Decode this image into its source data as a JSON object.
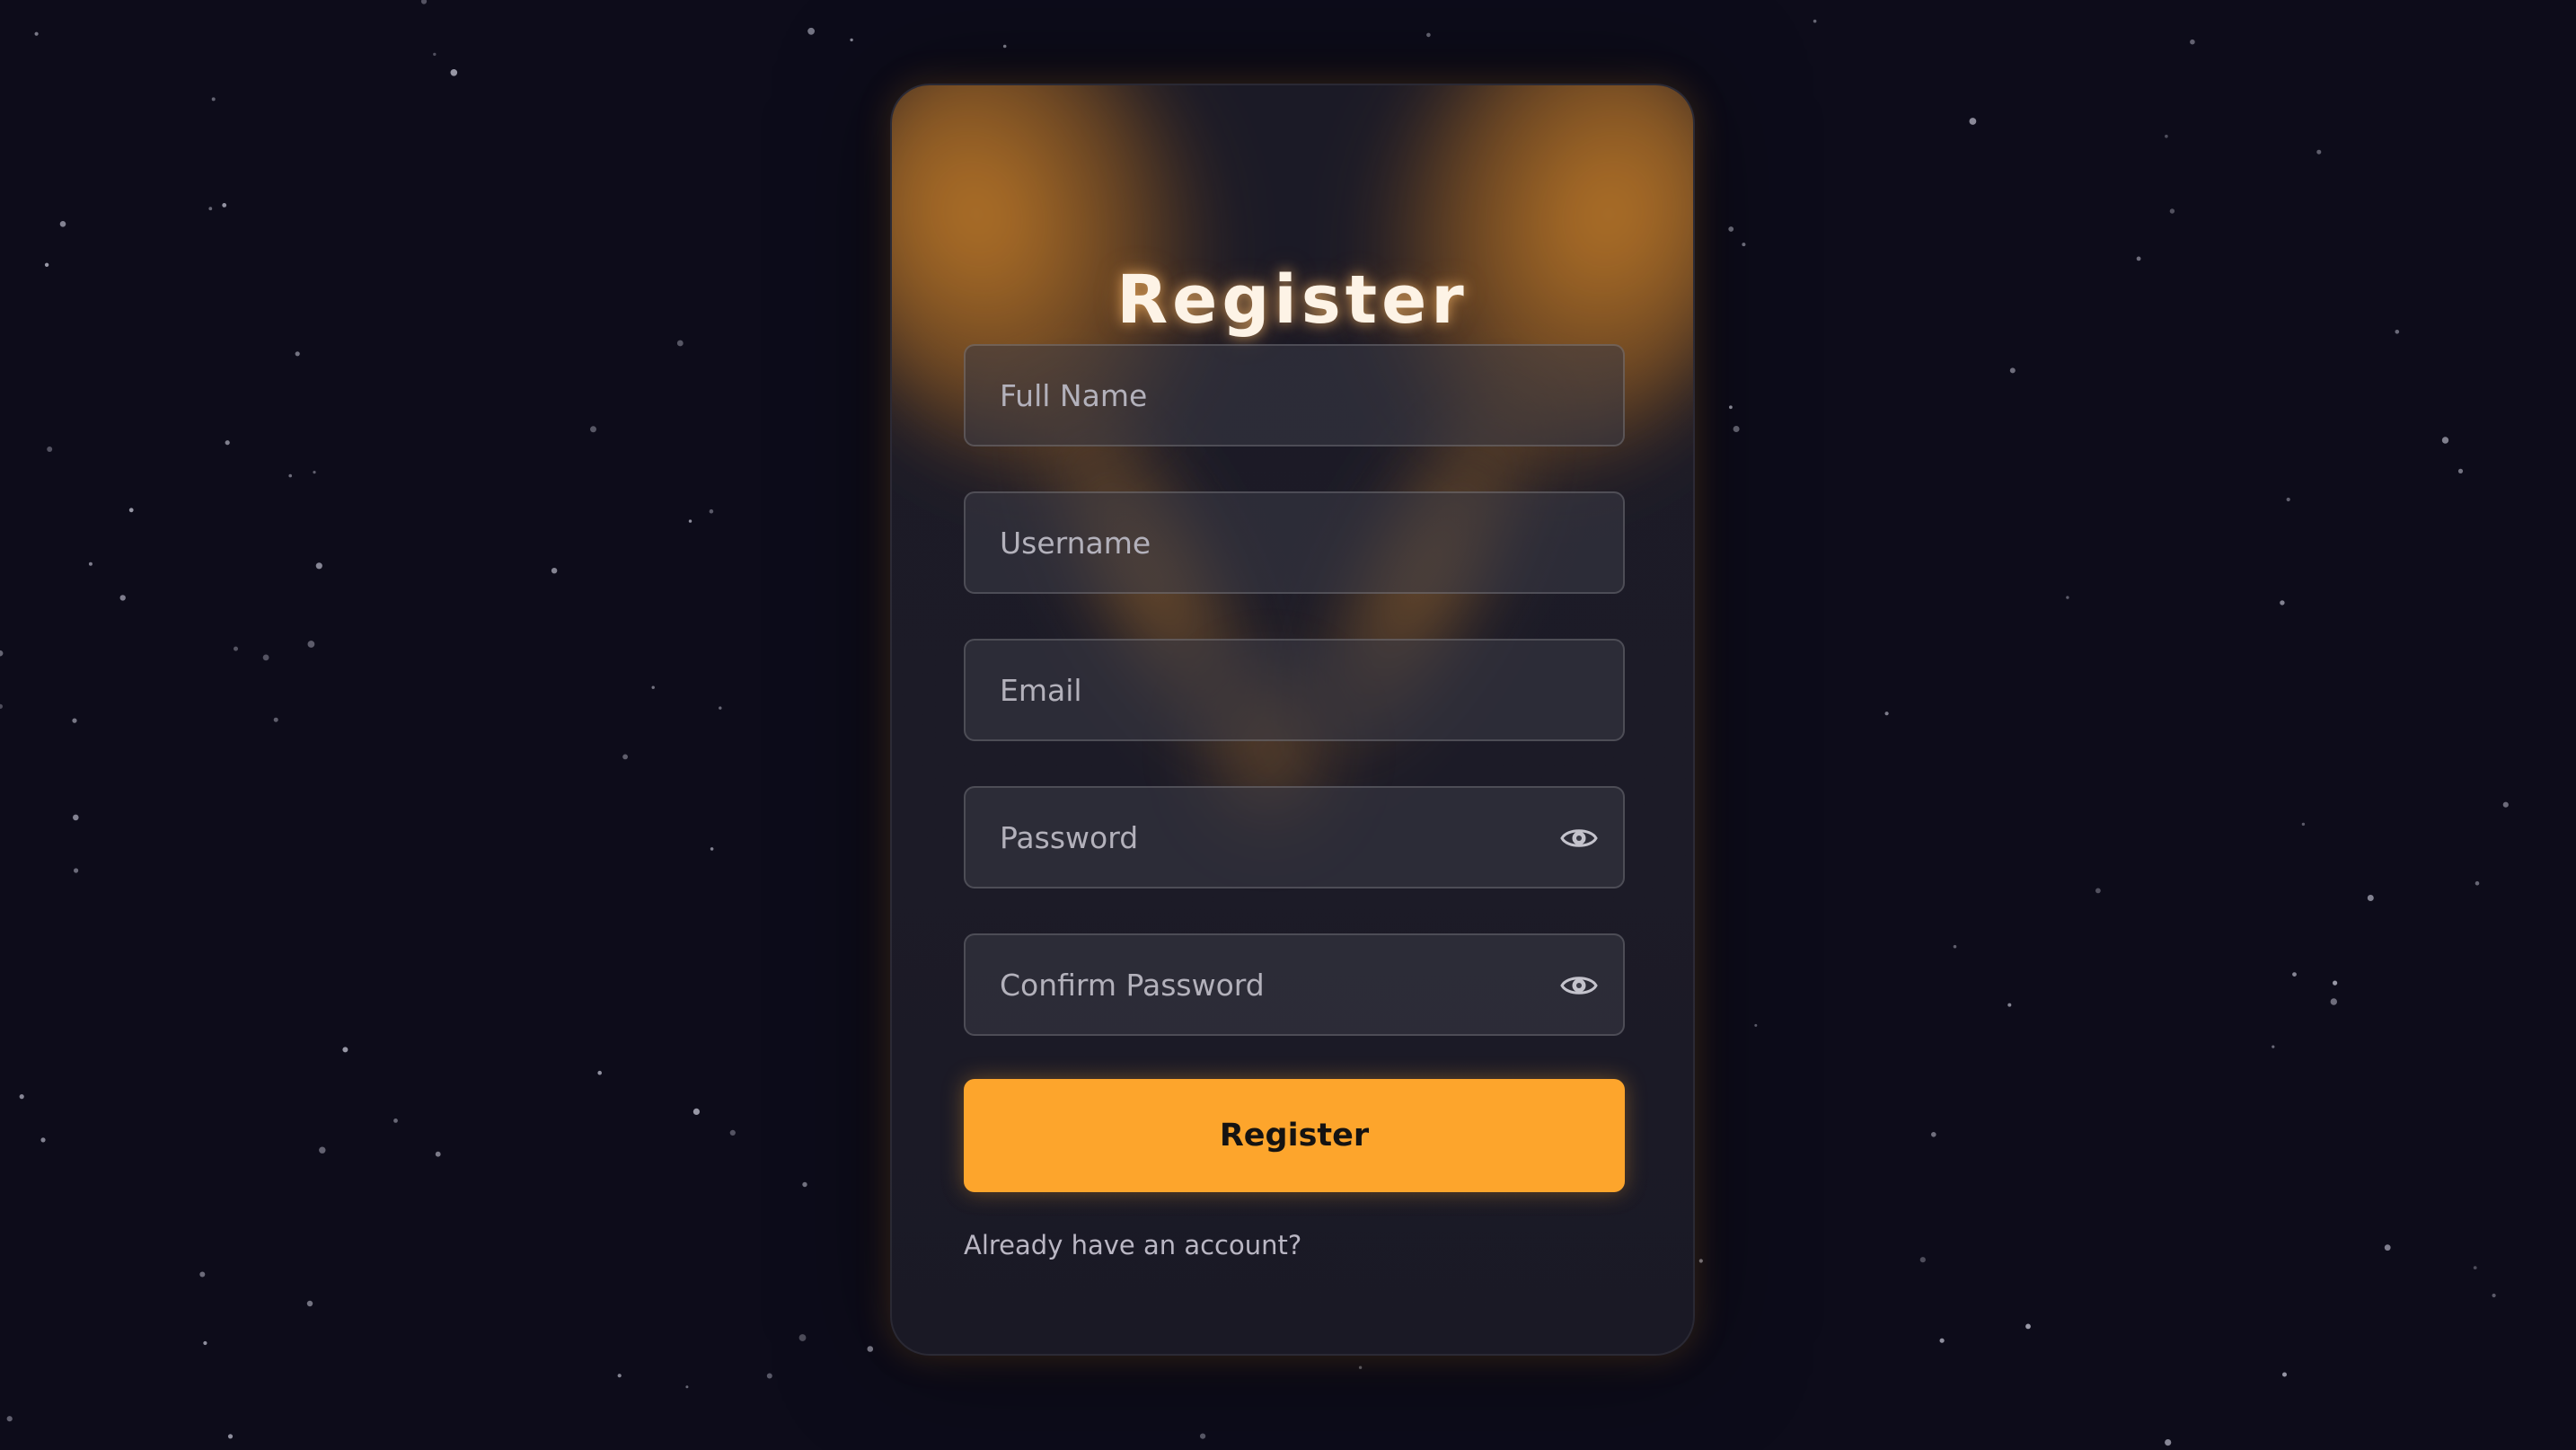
{
  "page": {
    "background_color": "#0d0c1a",
    "accent_color": "#fda52c"
  },
  "form": {
    "title": "Register",
    "fields": [
      {
        "name": "fullname",
        "placeholder": "Full Name",
        "value": ""
      },
      {
        "name": "username",
        "placeholder": "Username",
        "value": ""
      },
      {
        "name": "email",
        "placeholder": "Email",
        "value": ""
      },
      {
        "name": "password",
        "placeholder": "Password",
        "value": "",
        "icon": "eye-icon"
      },
      {
        "name": "confirm_password",
        "placeholder": "Confirm Password",
        "value": "",
        "icon": "eye-icon"
      }
    ],
    "submit_label": "Register",
    "login_link_text": "Already have an account?"
  }
}
